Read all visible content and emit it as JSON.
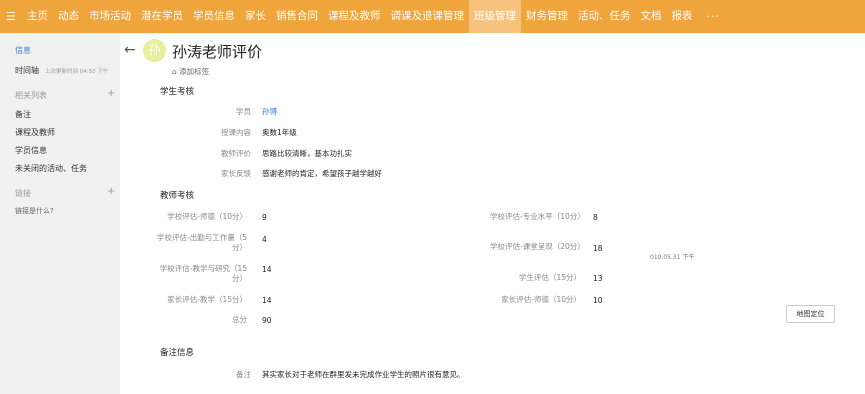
{
  "nav": {
    "menu_icon": "hamburger-icon",
    "items": [
      "主页",
      "动态",
      "市场活动",
      "潜在学员",
      "学员信息",
      "家长",
      "销售合同",
      "课程及教师",
      "调课及退课管理",
      "班级管理",
      "财务管理",
      "活动、任务",
      "文档",
      "报表"
    ],
    "active_index": 9,
    "more": "···",
    "accent": "#f0a43c"
  },
  "sidebar": {
    "info": "信息",
    "timeline": "时间轴",
    "timeline_meta": "上次更新时间 04:52 下午",
    "related_title": "相关列表",
    "related": [
      "备注",
      "课程及教师",
      "学员信息",
      "未关闭的活动、任务"
    ],
    "links_title": "链接",
    "link_question": "链接是什么?"
  },
  "record": {
    "avatar_char": "孙",
    "title": "孙涛老师评价",
    "add_tag": "添加标签"
  },
  "student_section": {
    "title": "学生考核",
    "rows": [
      {
        "label": "学员",
        "value": "孙博"
      },
      {
        "label": "授课内容",
        "value": "奥数1年级"
      },
      {
        "label": "教师评价",
        "value": "思路比较清晰，基本功扎实"
      },
      {
        "label": "家长反馈",
        "value": "感谢老师的肯定，希望孩子越学越好"
      }
    ]
  },
  "teacher_section": {
    "title": "教师考核",
    "left": [
      {
        "label": "学校评估-师德（10分）",
        "value": "9"
      },
      {
        "label": "学校评估-出勤与工作量（5分）",
        "value": "4"
      },
      {
        "label": "学校评估-教学与研究（15分）",
        "value": "14"
      },
      {
        "label": "家长评估-教学（15分）",
        "value": "14"
      },
      {
        "label": "总分",
        "value": "90"
      }
    ],
    "right": [
      {
        "label": "学校评估-专业水平（10分）",
        "value": "8"
      },
      {
        "label": "学校评估-课堂呈现（20分）",
        "value": "18"
      },
      {
        "label": "学生评估（15分）",
        "value": "13"
      },
      {
        "label": "家长评估-师德（10分）",
        "value": "10"
      }
    ],
    "timestamp": "010.05.31 下午",
    "map_button": "地图定位"
  },
  "notes_section": {
    "title": "备注信息",
    "label": "备注",
    "value": "其实家长对于老师在群里发未完成作业学生的照片很有意见。"
  }
}
